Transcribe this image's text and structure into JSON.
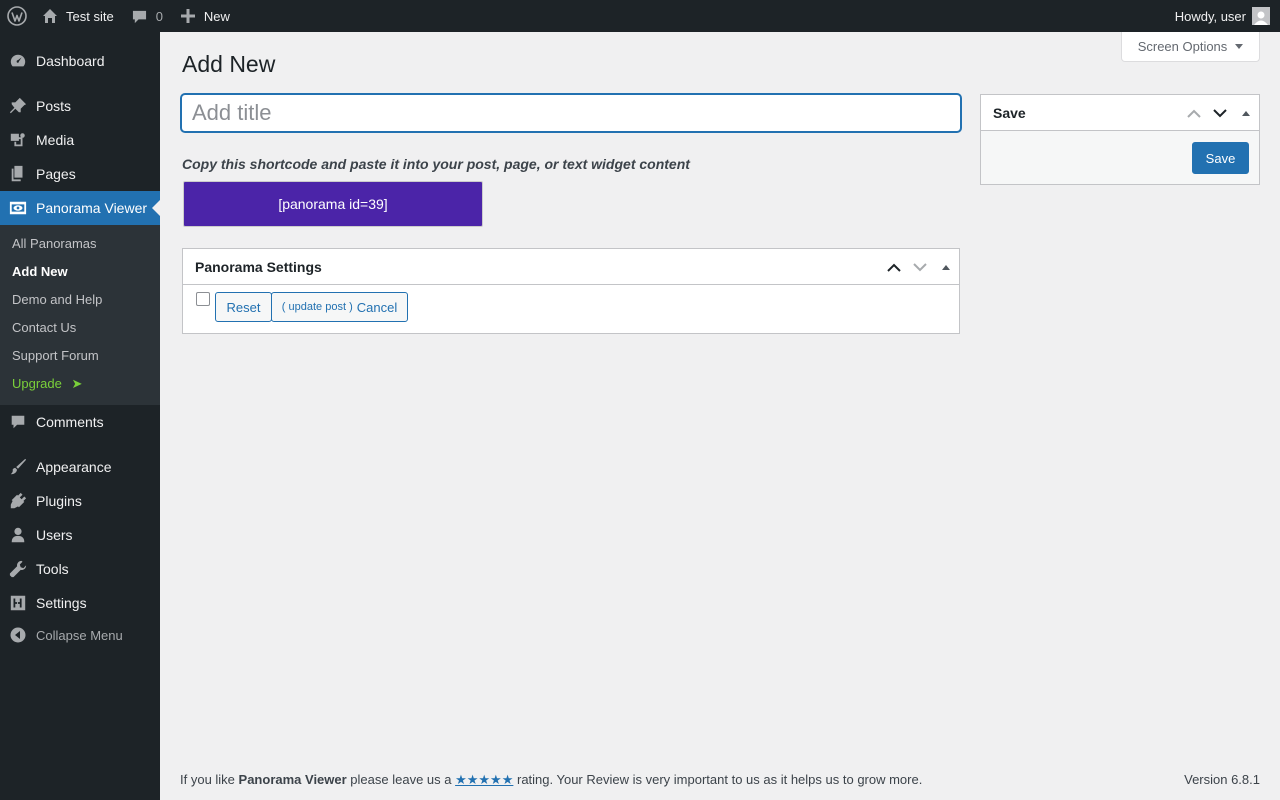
{
  "adminbar": {
    "site_name": "Test site",
    "comments_count": "0",
    "new_label": "New",
    "howdy": "Howdy, user"
  },
  "sidebar": {
    "items": [
      {
        "label": "Dashboard",
        "icon": "dashboard-icon"
      },
      {
        "label": "Posts",
        "icon": "pin-icon"
      },
      {
        "label": "Media",
        "icon": "media-icon"
      },
      {
        "label": "Pages",
        "icon": "pages-icon"
      },
      {
        "label": "Panorama Viewer",
        "icon": "eye-icon"
      },
      {
        "label": "Comments",
        "icon": "comment-icon"
      },
      {
        "label": "Appearance",
        "icon": "brush-icon"
      },
      {
        "label": "Plugins",
        "icon": "plugin-icon"
      },
      {
        "label": "Users",
        "icon": "user-icon"
      },
      {
        "label": "Tools",
        "icon": "wrench-icon"
      },
      {
        "label": "Settings",
        "icon": "settings-icon"
      }
    ],
    "submenu": [
      "All Panoramas",
      "Add New",
      "Demo and Help",
      "Contact Us",
      "Support Forum",
      "Upgrade"
    ],
    "collapse_label": "Collapse Menu"
  },
  "screen_options": "Screen Options",
  "page_title": "Add New",
  "title_placeholder": "Add title",
  "shortcode_hint": "Copy this shortcode and paste it into your post, page, or text widget content",
  "shortcode": "[panorama id=39]",
  "settings_box": {
    "title": "Panorama Settings",
    "reset_label": "Reset",
    "update_post_label": "( update post )",
    "cancel_label": "Cancel"
  },
  "save_box": {
    "title": "Save",
    "save_label": "Save"
  },
  "footer": {
    "prefix": "If you like ",
    "plugin_name": "Panorama Viewer",
    "middle": " please leave us a ",
    "stars": "★★★★★",
    "suffix": " rating. Your Review is very important to us as it helps us to grow more.",
    "version": "Version 6.8.1"
  },
  "colors": {
    "adminbar_bg": "#1d2327",
    "accent": "#2271b1",
    "shortcode_bg": "#4b24a8",
    "upgrade": "#7ad03a"
  }
}
